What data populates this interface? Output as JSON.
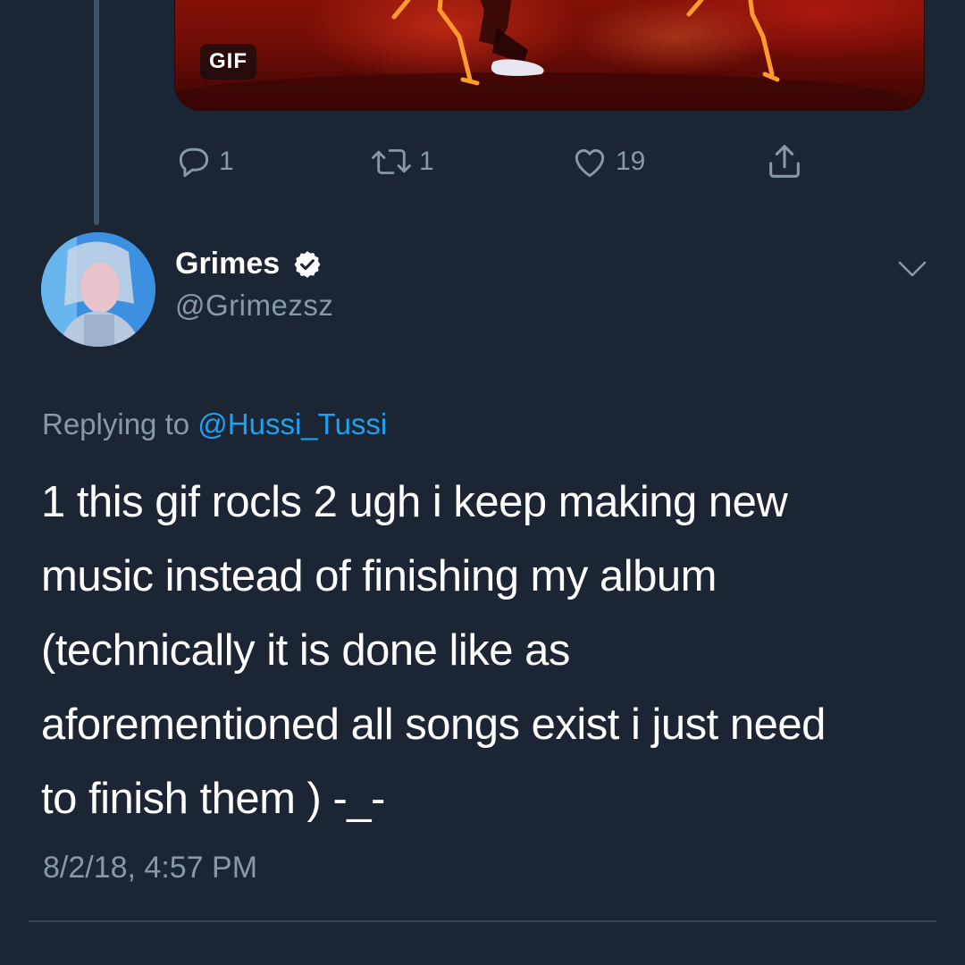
{
  "previous_tweet": {
    "media_badge": "GIF",
    "actions": {
      "reply": {
        "icon": "reply-icon",
        "count": "1"
      },
      "retweet": {
        "icon": "retweet-icon",
        "count": "1"
      },
      "like": {
        "icon": "heart-icon",
        "count": "19"
      },
      "share": {
        "icon": "share-icon"
      }
    }
  },
  "tweet": {
    "author": {
      "name": "Grimes",
      "handle": "@Grimezsz",
      "verified": true
    },
    "replying_label": "Replying to",
    "replying_to": "@Hussi_Tussi",
    "text_lines": [
      "1 this gif rocls 2 ugh i keep making new",
      "music instead of finishing my album",
      "(technically it is done like as",
      "aforementioned all songs exist i just need",
      "to finish them ) -_-"
    ],
    "timestamp": "8/2/18, 4:57 PM"
  },
  "colors": {
    "background": "#1c2533",
    "text": "#ffffff",
    "muted": "#8899a6",
    "link": "#1da1f2",
    "divider": "#38444d"
  }
}
